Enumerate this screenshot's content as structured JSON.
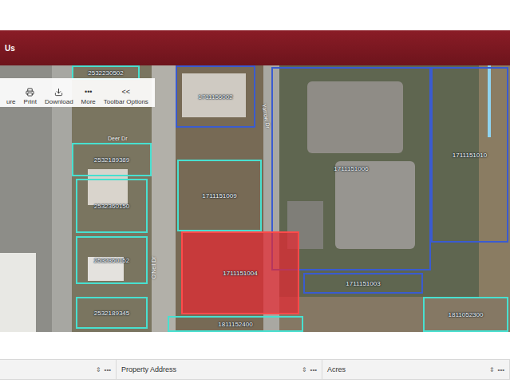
{
  "header": {
    "title": "Us"
  },
  "toolbar": {
    "items": [
      {
        "label": "ure",
        "icon": ""
      },
      {
        "label": "Print",
        "icon": "printer"
      },
      {
        "label": "Download",
        "icon": "download"
      },
      {
        "label": "More",
        "icon": "•••"
      },
      {
        "label": "Toolbar Options",
        "icon": "<<"
      }
    ]
  },
  "map": {
    "parcels": [
      {
        "label": "2532230502",
        "selected": false
      },
      {
        "label": "1711156002",
        "selected": false
      },
      {
        "label": "2532189389",
        "selected": false
      },
      {
        "label": "2532360150",
        "selected": false
      },
      {
        "label": "1711151009",
        "selected": false
      },
      {
        "label": "1711151006",
        "selected": false
      },
      {
        "label": "1711151010",
        "selected": false
      },
      {
        "label": "1711151004",
        "selected": true
      },
      {
        "label": "2532360152",
        "selected": false
      },
      {
        "label": "1711151003",
        "selected": false
      },
      {
        "label": "2532189345",
        "selected": false
      },
      {
        "label": "1811152400",
        "selected": false
      },
      {
        "label": "1811052300",
        "selected": false
      }
    ],
    "streets": [
      {
        "label": "O'Neil Dr"
      },
      {
        "label": "Yarrow Dr"
      },
      {
        "label": "Deer Dr"
      }
    ]
  },
  "table": {
    "columns": [
      {
        "label": "",
        "sort": "⇕",
        "menu": "•••"
      },
      {
        "label": "Property Address",
        "sort": "⇕",
        "menu": "•••"
      },
      {
        "label": "Acres",
        "sort": "⇕",
        "menu": "•••"
      }
    ]
  }
}
